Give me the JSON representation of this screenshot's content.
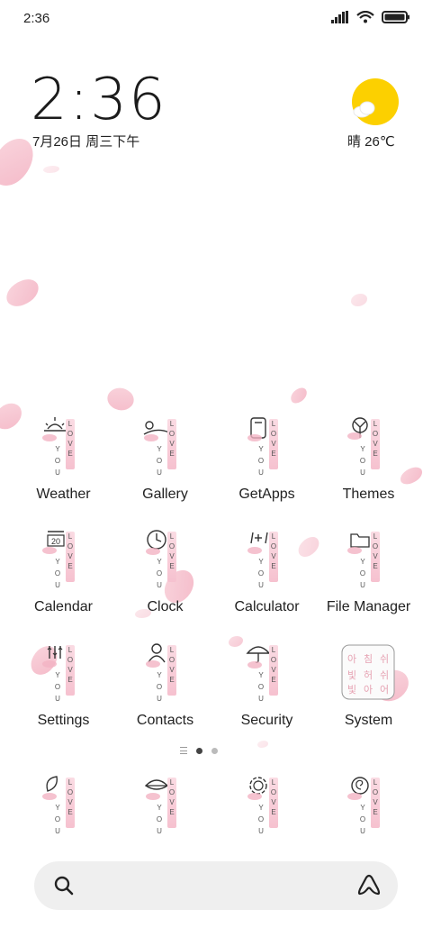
{
  "status_bar": {
    "time": "2:36"
  },
  "clock_widget": {
    "time": "2:36",
    "date": "7月26日 周三下午"
  },
  "weather_widget": {
    "text": "晴 26℃"
  },
  "icon_text": {
    "love": [
      "L",
      "O",
      "V",
      "E"
    ],
    "you": [
      "Y",
      "O",
      "U"
    ],
    "calendar_day": "20"
  },
  "apps": [
    {
      "label": "Weather"
    },
    {
      "label": "Gallery"
    },
    {
      "label": "GetApps"
    },
    {
      "label": "Themes"
    },
    {
      "label": "Calendar"
    },
    {
      "label": "Clock"
    },
    {
      "label": "Calculator"
    },
    {
      "label": "File Manager"
    },
    {
      "label": "Settings"
    },
    {
      "label": "Contacts"
    },
    {
      "label": "Security"
    },
    {
      "label": "System"
    }
  ],
  "dock_apps": [
    "leaf-app",
    "chat-app",
    "flower-app",
    "spiral-app"
  ],
  "system_folder_glyphs": [
    "아",
    "침",
    "쉬",
    "빛",
    "허",
    "쉬",
    "빛",
    "아",
    "어"
  ],
  "colors": {
    "petal": "#f3b3c3",
    "sun": "#fcd000",
    "search_bg": "#efefef"
  }
}
